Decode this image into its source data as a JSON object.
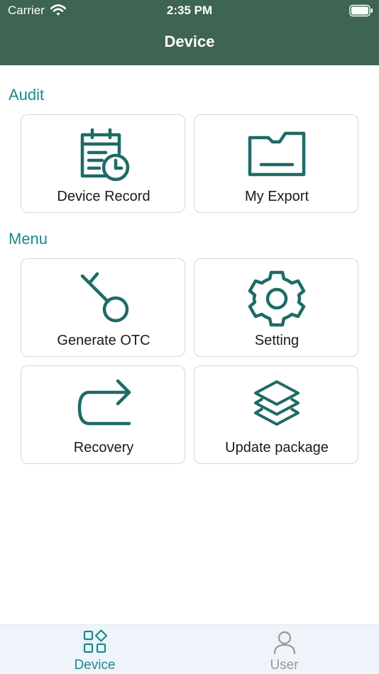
{
  "status_bar": {
    "carrier": "Carrier",
    "time": "2:35 PM",
    "wifi_icon": "wifi-icon",
    "battery_icon": "battery-icon"
  },
  "nav": {
    "title": "Device"
  },
  "sections": {
    "audit": {
      "title": "Audit",
      "items": [
        {
          "label": "Device Record",
          "icon": "calendar-clock-icon"
        },
        {
          "label": "My Export",
          "icon": "folder-icon"
        }
      ]
    },
    "menu": {
      "title": "Menu",
      "items": [
        {
          "label": "Generate OTC",
          "icon": "key-icon"
        },
        {
          "label": "Setting",
          "icon": "gear-icon"
        },
        {
          "label": "Recovery",
          "icon": "u-turn-arrow-icon"
        },
        {
          "label": "Update package",
          "icon": "layers-icon"
        }
      ]
    }
  },
  "tab_bar": {
    "tabs": [
      {
        "label": "Device",
        "icon": "grid-icon",
        "active": true
      },
      {
        "label": "User",
        "icon": "user-icon",
        "active": false
      }
    ]
  },
  "colors": {
    "header": "#3e6452",
    "accent": "#1a8a8a",
    "icon": "#1f6b66",
    "inactive": "#9a9a9a"
  }
}
